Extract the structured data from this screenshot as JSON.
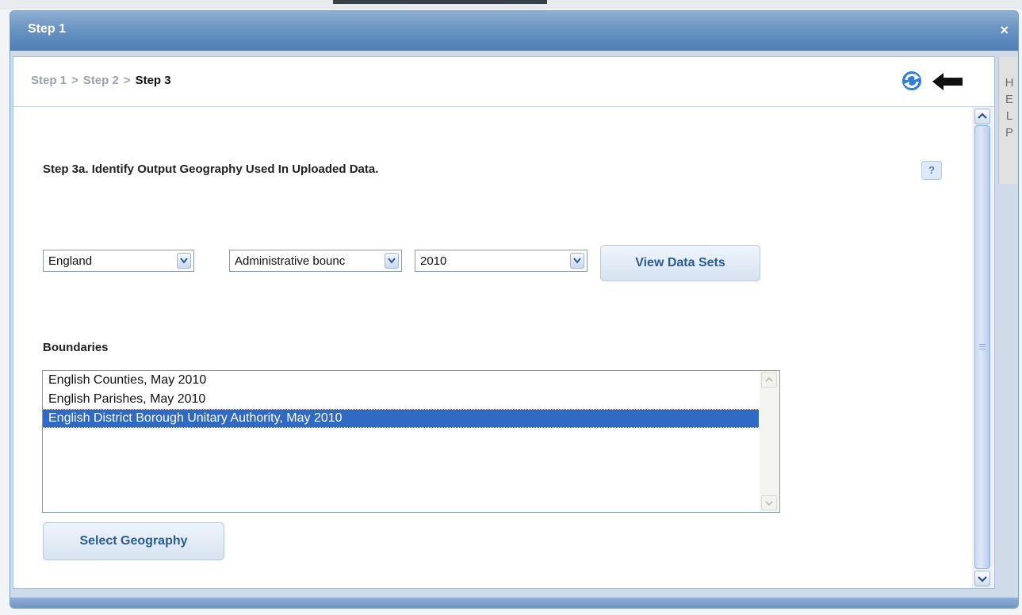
{
  "window": {
    "title": "Step 1",
    "close_label": "×"
  },
  "breadcrumb": {
    "step1": "Step 1",
    "step2": "Step 2",
    "step3": "Step 3",
    "separator": ">"
  },
  "section": {
    "title": "Step 3a. Identify Output Geography Used In Uploaded Data.",
    "help_label": "?"
  },
  "filters": {
    "country": "England",
    "boundary_type": "Administrative bounc",
    "year": "2010",
    "view_button": "View Data Sets"
  },
  "boundaries": {
    "label": "Boundaries",
    "items": [
      "English Counties, May 2010",
      "English Parishes, May 2010",
      "English District Borough Unitary Authority, May 2010"
    ],
    "selected_index": 2
  },
  "select_button": "Select Geography",
  "help_tab": {
    "letters": [
      "H",
      "E",
      "L",
      "P"
    ]
  },
  "colors": {
    "accent": "#316ac5",
    "titlebar": "#6a94c2",
    "button_text": "#2a5b93"
  },
  "icons": {
    "refresh": "refresh-icon",
    "back": "back-arrow-icon",
    "dropdown": "chevron-down-icon"
  }
}
